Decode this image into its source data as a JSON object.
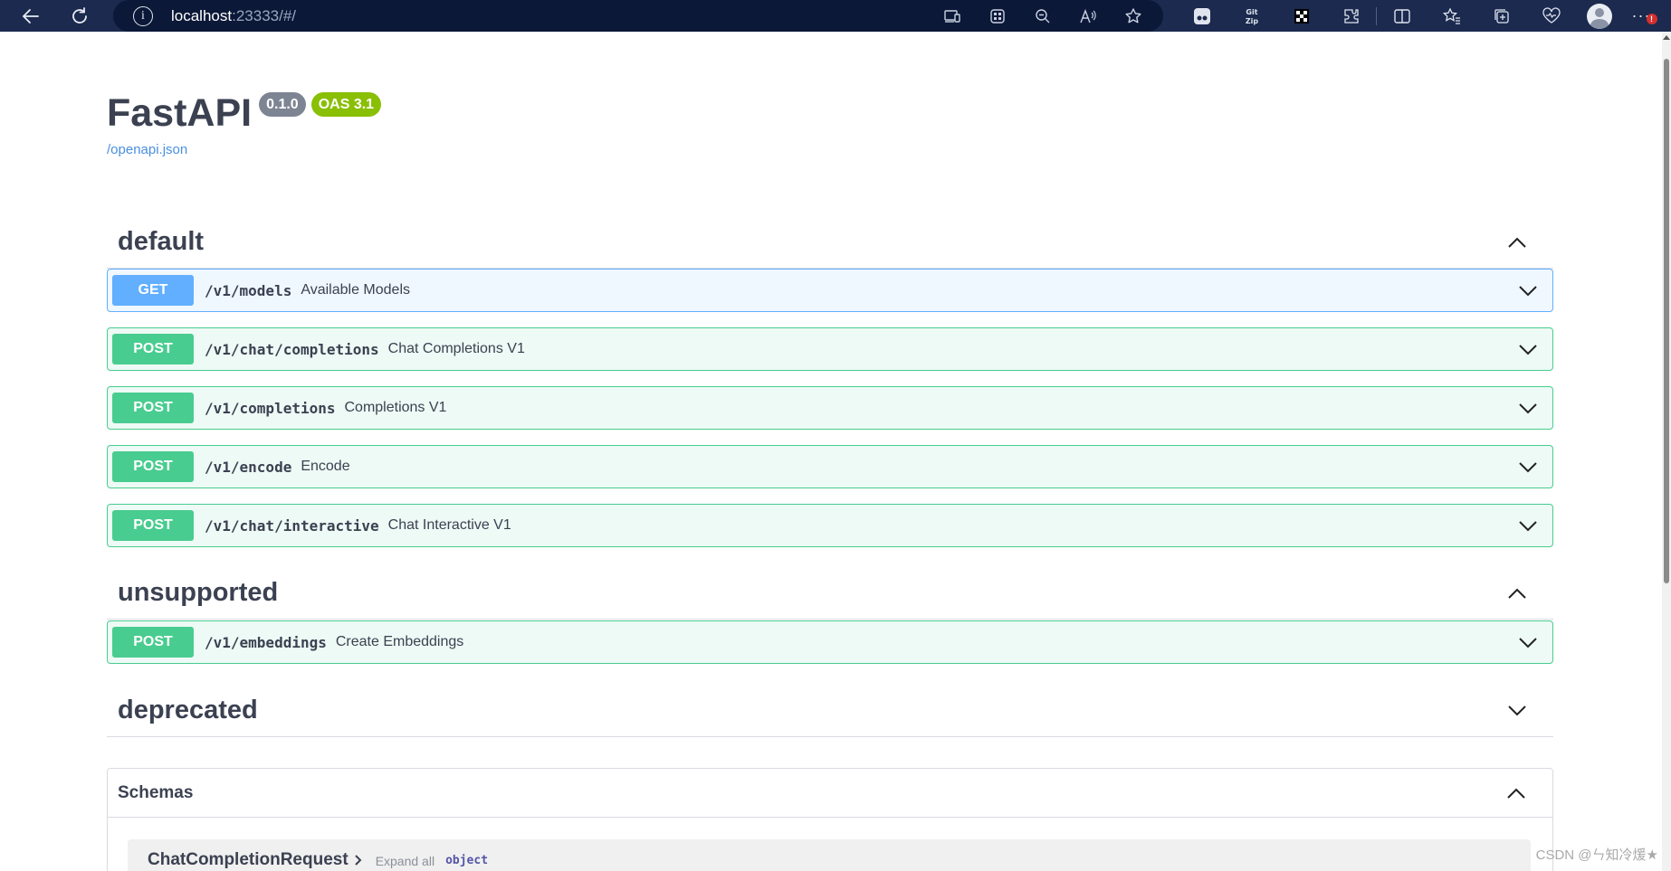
{
  "browser": {
    "url_host": "localhost",
    "url_rest": ":23333/#/",
    "icons": [
      "back-icon",
      "refresh-icon",
      "info-icon",
      "device-icon",
      "apps-icon",
      "zoom-out-icon",
      "read-aloud-icon",
      "favorite-star-icon",
      "extension-icon",
      "split-screen-icon",
      "favorites-icon",
      "collections-icon",
      "health-icon",
      "profile-icon",
      "more-icon"
    ],
    "ext_gitzip_label": "Git\nZip",
    "notification_badge": "!"
  },
  "info": {
    "title": "FastAPI",
    "version": "0.1.0",
    "oas": "OAS 3.1",
    "openapi_link": "/openapi.json"
  },
  "tags": [
    {
      "name": "default",
      "expanded": true,
      "operations": [
        {
          "method": "GET",
          "path": "/v1/models",
          "summary": "Available Models"
        },
        {
          "method": "POST",
          "path": "/v1/chat/completions",
          "summary": "Chat Completions V1"
        },
        {
          "method": "POST",
          "path": "/v1/completions",
          "summary": "Completions V1"
        },
        {
          "method": "POST",
          "path": "/v1/encode",
          "summary": "Encode"
        },
        {
          "method": "POST",
          "path": "/v1/chat/interactive",
          "summary": "Chat Interactive V1"
        }
      ]
    },
    {
      "name": "unsupported",
      "expanded": true,
      "operations": [
        {
          "method": "POST",
          "path": "/v1/embeddings",
          "summary": "Create Embeddings"
        }
      ]
    },
    {
      "name": "deprecated",
      "expanded": false,
      "operations": []
    }
  ],
  "schemas": {
    "title": "Schemas",
    "first_model": "ChatCompletionRequest",
    "expand_all": "Expand all",
    "type": "object"
  },
  "watermark": "CSDN @ㄣ知冷煖★",
  "colors": {
    "get": "#61affe",
    "post": "#49cc90",
    "version_badge": "#7d8492",
    "oas_badge": "#89bf04",
    "link": "#4990e2"
  }
}
